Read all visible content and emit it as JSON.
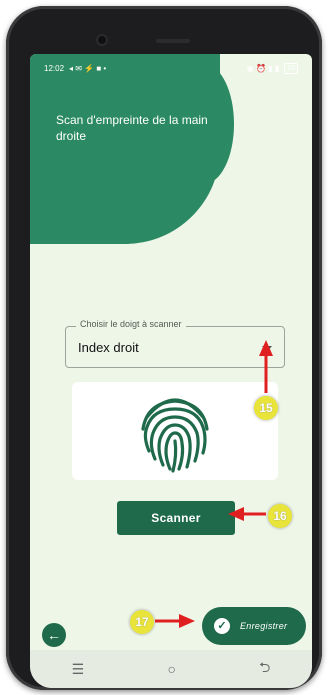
{
  "status_bar": {
    "time": "12:02",
    "battery": "69"
  },
  "header": {
    "title": "Scan d'empreinte de la main droite"
  },
  "finger_select": {
    "label": "Choisir le doigt à scanner",
    "value": "Index droit"
  },
  "actions": {
    "scan_label": "Scanner",
    "save_label": "Enregistrer"
  },
  "nav": {
    "recents_glyph": "☰",
    "home_glyph": "○",
    "back_glyph": "⮌"
  },
  "annotations": [
    {
      "number": "15"
    },
    {
      "number": "16"
    },
    {
      "number": "17"
    }
  ],
  "colors": {
    "brand_green": "#2b8a63",
    "dark_green": "#1e6a4b",
    "screen_bg": "#eef6e8",
    "callout_yellow": "#e8e43a",
    "arrow_red": "#e02020"
  },
  "icons": [
    "fingerprint-icon",
    "dropdown-caret-icon",
    "back-arrow-icon",
    "check-icon"
  ]
}
